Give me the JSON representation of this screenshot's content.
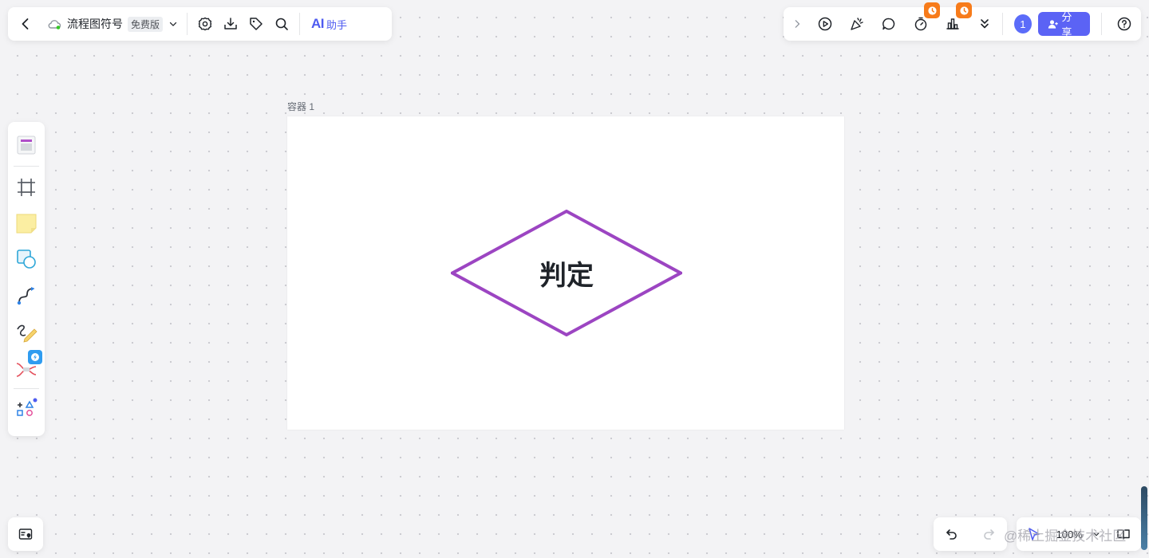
{
  "toolbar_left": {
    "doc_title": "流程图符号",
    "plan_badge": "免费版",
    "ai_mark": "AI",
    "ai_text": "助手"
  },
  "toolbar_right": {
    "collaborator_count": "1",
    "share_label": "分享"
  },
  "canvas": {
    "container_label": "容器 1",
    "shape_text": "判定",
    "shape_stroke_color": "#9c45c2"
  },
  "zoom": {
    "level": "100%"
  },
  "watermark": "@稀土掘金技术社区",
  "colors": {
    "accent": "#5b63f5",
    "badge_orange": "#f77b1a"
  }
}
